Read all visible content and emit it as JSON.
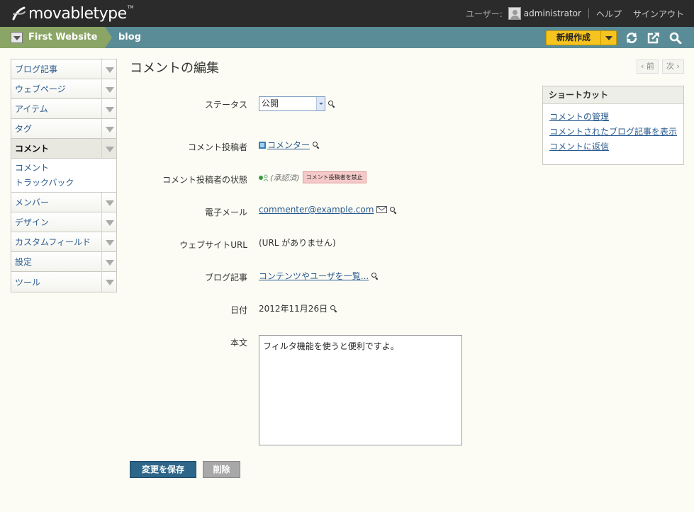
{
  "topbar": {
    "logo_text": "movabletype",
    "logo_tm": "TM",
    "user_label": "ユーザー:",
    "username": "administrator",
    "help": "ヘルプ",
    "signout": "サインアウト"
  },
  "sitebar": {
    "website": "First Website",
    "blog": "blog",
    "new_button": "新規作成"
  },
  "menu": {
    "items": [
      {
        "label": "ブログ記事"
      },
      {
        "label": "ウェブページ"
      },
      {
        "label": "アイテム"
      },
      {
        "label": "タグ"
      },
      {
        "label": "コメント"
      },
      {
        "label": "メンバー"
      },
      {
        "label": "デザイン"
      },
      {
        "label": "カスタムフィールド"
      },
      {
        "label": "設定"
      },
      {
        "label": "ツール"
      }
    ],
    "submenu": [
      "コメント",
      "トラックバック"
    ]
  },
  "page": {
    "title": "コメントの編集",
    "prev": "‹ 前",
    "next": "次 ›"
  },
  "form": {
    "status_label": "ステータス",
    "status_value": "公開",
    "commenter_label": "コメント投稿者",
    "commenter_value": "コメンター",
    "commenter_state_label": "コメント投稿者の状態",
    "commenter_state_value": "(承認済)",
    "ban_button": "コメント投稿者を禁止",
    "email_label": "電子メール",
    "email_value": "commenter@example.com",
    "website_label": "ウェブサイトURL",
    "website_value": "(URL がありません)",
    "entry_label": "ブログ記事",
    "entry_value": "コンテンツやユーザを一覧...",
    "date_label": "日付",
    "date_value": "2012年11月26日",
    "body_label": "本文",
    "body_value": "フィルタ機能を使うと便利ですよ。"
  },
  "actions": {
    "save": "変更を保存",
    "delete": "削除"
  },
  "shortcut": {
    "title": "ショートカット",
    "links": [
      "コメントの管理",
      "コメントされたブログ記事を表示",
      "コメントに返信"
    ]
  },
  "colors": {
    "topbar": "#2b2b2b",
    "sitebar": "#5a8c97",
    "site_crumb": "#8aa565",
    "new_button": "#f7c41f",
    "save_button": "#2d6689",
    "link": "#2a5b8e"
  },
  "icons": {
    "logo": "movabletype-swirl-icon",
    "refresh": "refresh-icon",
    "view_site": "external-link-icon",
    "search": "search-icon"
  }
}
